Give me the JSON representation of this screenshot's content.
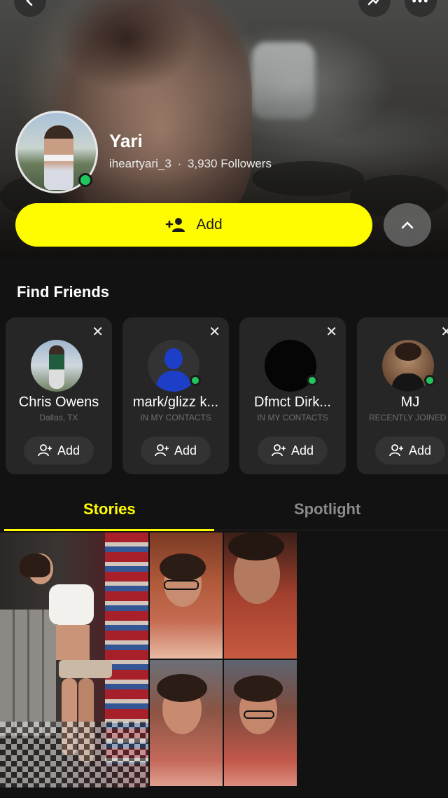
{
  "profile": {
    "name": "Yari",
    "username": "iheartyari_3",
    "separator": "·",
    "followers": "3,930 Followers",
    "add_label": "Add"
  },
  "find_friends": {
    "title": "Find Friends",
    "cards": [
      {
        "name": "Chris Owens",
        "subtitle": "Dallas, TX",
        "add_label": "Add"
      },
      {
        "name": "mark/glizz k...",
        "subtitle": "IN MY CONTACTS",
        "add_label": "Add"
      },
      {
        "name": "Dfmct Dirk...",
        "subtitle": "IN MY CONTACTS",
        "add_label": "Add"
      },
      {
        "name": "MJ",
        "subtitle": "RECENTLY JOINED",
        "add_label": "Add"
      }
    ]
  },
  "tabs": [
    {
      "label": "Stories",
      "active": true
    },
    {
      "label": "Spotlight",
      "active": false
    }
  ],
  "colors": {
    "accent": "#fffc00",
    "online": "#22c55e",
    "background": "#121212",
    "card": "#262626"
  },
  "icons": [
    "back-icon",
    "share-icon",
    "more-icon",
    "add-friend-icon",
    "chevron-up-icon",
    "close-icon",
    "online-indicator"
  ]
}
